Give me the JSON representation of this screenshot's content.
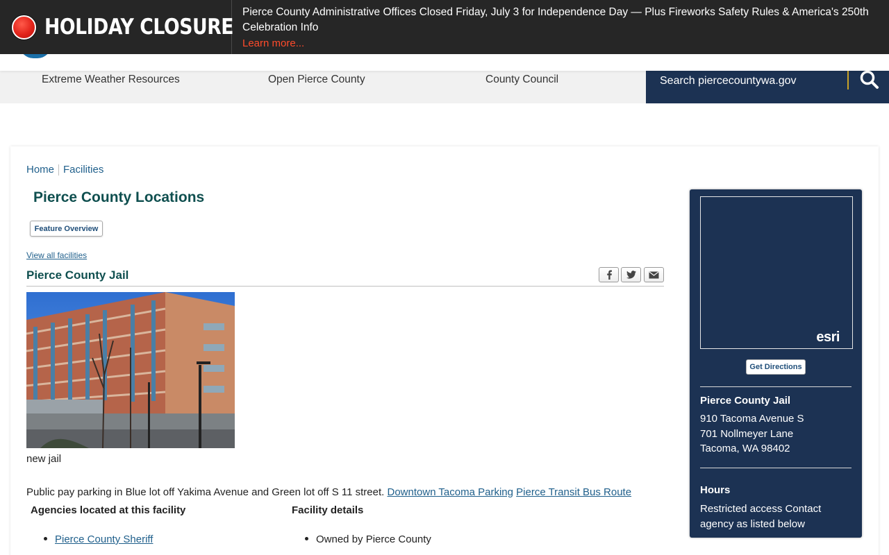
{
  "alert": {
    "title": "HOLIDAY CLOSURE",
    "message": "Pierce County Administrative Offices Closed Friday, July 3 for Independence Day — Plus Fireworks Safety Rules & America's 250th Celebration Info",
    "link": "Learn more..."
  },
  "nav": {
    "items": [
      {
        "label": "Extreme Weather Resources"
      },
      {
        "label": "Open Pierce County"
      },
      {
        "label": "County Council"
      }
    ]
  },
  "search": {
    "placeholder": "Search piercecountywa.gov",
    "icon": "search-icon"
  },
  "breadcrumb": {
    "home": "Home",
    "current": "Facilities"
  },
  "page": {
    "title": "Pierce County Locations",
    "feature_button": "Feature Overview",
    "view_all": "View all facilities"
  },
  "facility": {
    "name": "Pierce County Jail",
    "share_icons": [
      "facebook-icon",
      "twitter-icon",
      "email-icon"
    ],
    "photo_caption": "new jail",
    "parking_text": "Public pay parking in Blue lot off Yakima Avenue and Green lot off S 11 street.",
    "parking_link_1": "Downtown Tacoma Parking",
    "parking_link_2": "Pierce  Transit Bus Route",
    "agencies_heading": "Agencies located at this facility",
    "agencies": [
      "Pierce County Sheriff"
    ],
    "details_heading": "Facility details",
    "details": [
      "Owned by Pierce County"
    ]
  },
  "sidebar": {
    "map_logo": "esri",
    "directions_button": "Get Directions",
    "name": "Pierce County Jail",
    "address_line_1": "910 Tacoma Avenue S",
    "address_line_2": "701 Nollmeyer Lane",
    "address_line_3": "Tacoma, WA 98402",
    "hours_heading": "Hours",
    "hours_text": "Restricted access Contact agency as listed below"
  },
  "colors": {
    "alert_bg": "#262626",
    "alert_link": "#ff4b2b",
    "navy": "#1c3253",
    "accent_gold": "#c9a227",
    "title_green": "#0f4f4f",
    "link_blue": "#1f5f8b"
  }
}
